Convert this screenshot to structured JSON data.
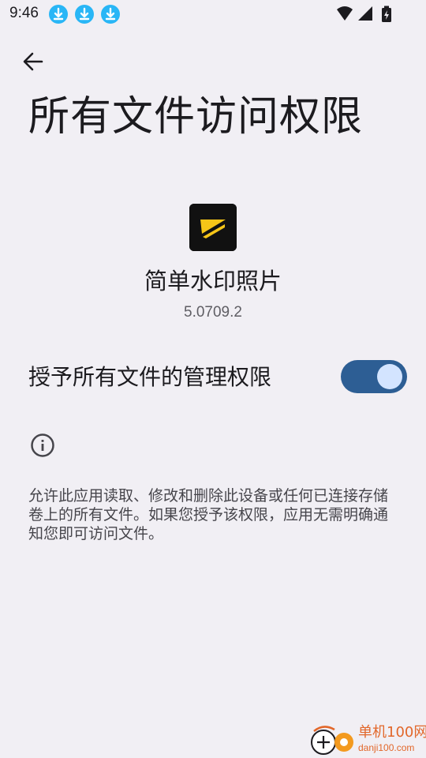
{
  "status_bar": {
    "time": "9:46",
    "notification_icons": [
      "download-icon",
      "download-icon",
      "download-icon"
    ],
    "system_icons": [
      "wifi-icon",
      "signal-icon",
      "battery-charging-icon"
    ]
  },
  "header": {
    "back_icon": "arrow-back-icon",
    "title": "所有文件访问权限"
  },
  "app": {
    "name": "简单水印照片",
    "version": "5.0709.2"
  },
  "permission": {
    "label": "授予所有文件的管理权限",
    "enabled": true
  },
  "info": {
    "icon": "info-icon",
    "description": "允许此应用读取、修改和删除此设备或任何已连接存储卷上的所有文件。如果您授予该权限，应用无需明确通知您即可访问文件。"
  },
  "watermark": {
    "text": "单机100网",
    "url": "danji100.com"
  },
  "colors": {
    "background": "#f1eff4",
    "toggle_track": "#2d5e94",
    "toggle_thumb": "#d3e4ff",
    "notification_icon": "#29b6f6",
    "app_icon_accent": "#f5c518",
    "watermark": "#e2672a"
  }
}
